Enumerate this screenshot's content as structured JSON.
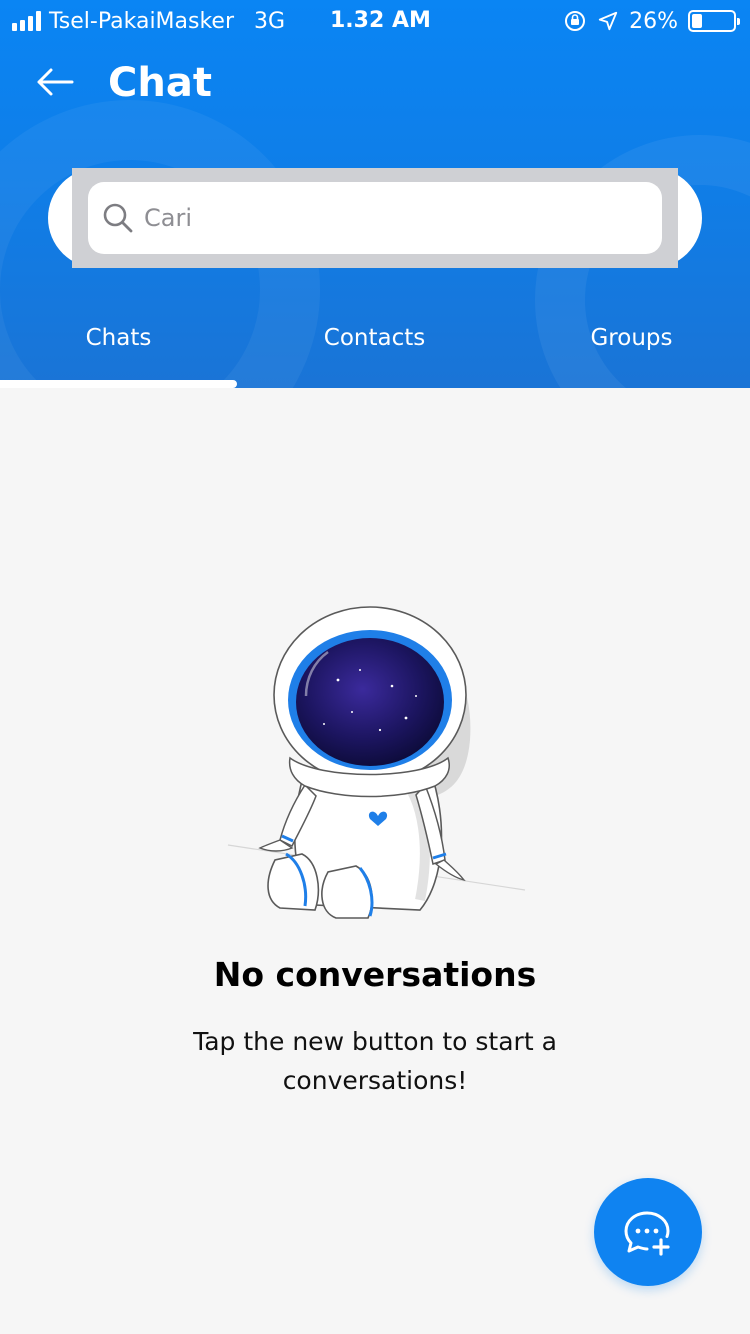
{
  "status_bar": {
    "carrier": "Tsel-PakaiMasker",
    "network": "3G",
    "time": "1.32 AM",
    "battery": "26%",
    "battery_level": 0.26,
    "icons": [
      "signal-icon",
      "orientation-lock-icon",
      "location-arrow-icon",
      "battery-icon"
    ]
  },
  "header": {
    "title": "Chat",
    "back_icon": "arrow-left-icon"
  },
  "search": {
    "placeholder": "Cari",
    "icon": "search-icon"
  },
  "tabs": [
    {
      "label": "Chats",
      "active": true
    },
    {
      "label": "Contacts",
      "active": false
    },
    {
      "label": "Groups",
      "active": false
    }
  ],
  "empty_state": {
    "illustration": "astronaut-illustration",
    "title": "No conversations",
    "subtitle": "Tap the new button to start a conversations!"
  },
  "fab": {
    "icon": "new-chat-icon"
  },
  "colors": {
    "primary": "#0f83f1",
    "header_top": "#0a85f4",
    "header_bottom": "#1a74d6",
    "background": "#f6f6f6"
  }
}
